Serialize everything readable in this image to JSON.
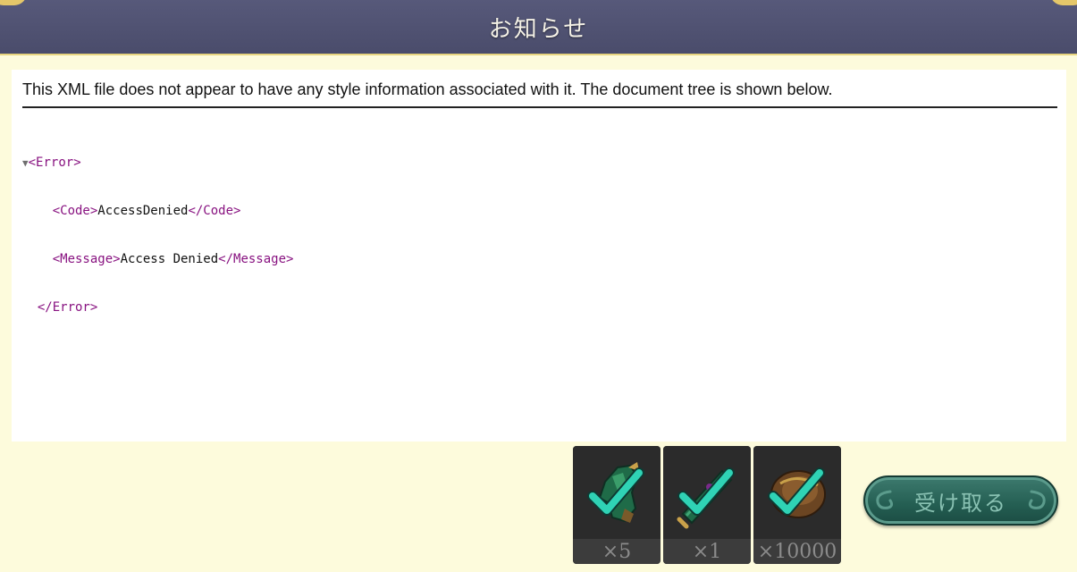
{
  "header": {
    "title": "お知らせ"
  },
  "notice": {
    "message": "This XML file does not appear to have any style information associated with it. The document tree is shown below.",
    "tree": {
      "toggle": "▼",
      "error_open": "<Error>",
      "code_open": "<Code>",
      "code_value": "AccessDenied",
      "code_close": "</Code>",
      "message_open": "<Message>",
      "message_value": "Access Denied",
      "message_close": "</Message>",
      "error_close": "</Error>"
    }
  },
  "rewards": [
    {
      "icon": "green-armor-icon",
      "quantity": "×5",
      "claimed": true
    },
    {
      "icon": "green-scroll-icon",
      "quantity": "×1",
      "claimed": true
    },
    {
      "icon": "coin-pouch-icon",
      "quantity": "×10000",
      "claimed": true
    }
  ],
  "receive_button": {
    "label": "受け取る"
  },
  "colors": {
    "header_bg": "#4a4c6b",
    "page_bg": "#fdfbdc",
    "xml_tag": "#881280",
    "checkmark": "#2fd3b5",
    "button_bg": "#245e52"
  }
}
